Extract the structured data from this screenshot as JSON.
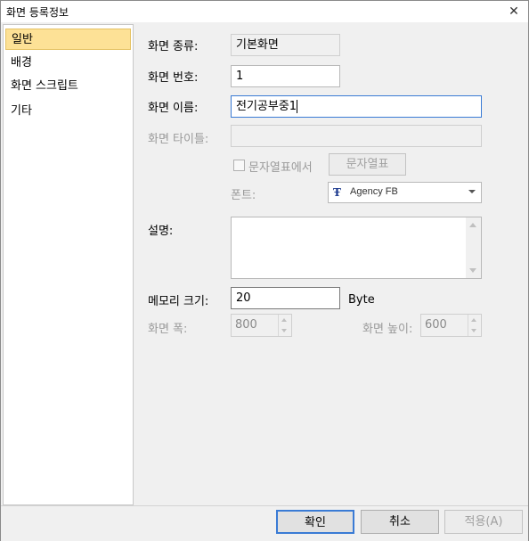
{
  "window": {
    "title": "화면 등록정보",
    "close_label": "✕"
  },
  "sidebar": {
    "items": [
      {
        "label": "일반",
        "active": true
      },
      {
        "label": "배경"
      },
      {
        "label": "화면 스크립트"
      },
      {
        "label": "기타"
      }
    ]
  },
  "form": {
    "screen_type": {
      "label": "화면 종류:",
      "value": "기본화면"
    },
    "screen_number": {
      "label": "화면 번호:",
      "value": "1"
    },
    "screen_name": {
      "label": "화면 이름:",
      "value": "전기공부중1"
    },
    "screen_title": {
      "label": "화면 타이틀:",
      "value": ""
    },
    "string_table": {
      "checkbox_label": "문자열표에서",
      "button_label": "문자열표",
      "checked": false
    },
    "font": {
      "label": "폰트:",
      "icon": "truetype-icon",
      "value": "Agency FB"
    },
    "description": {
      "label": "설명:",
      "value": ""
    },
    "memory": {
      "label": "메모리 크기:",
      "value": "20",
      "unit": "Byte"
    },
    "width": {
      "label": "화면 폭:",
      "value": "800"
    },
    "height": {
      "label": "화면 높이:",
      "value": "600"
    }
  },
  "buttons": {
    "ok": "확인",
    "cancel": "취소",
    "apply": "적용(A)"
  },
  "colors": {
    "active_item": "#fde196",
    "focus_border": "#3a7bd5"
  }
}
